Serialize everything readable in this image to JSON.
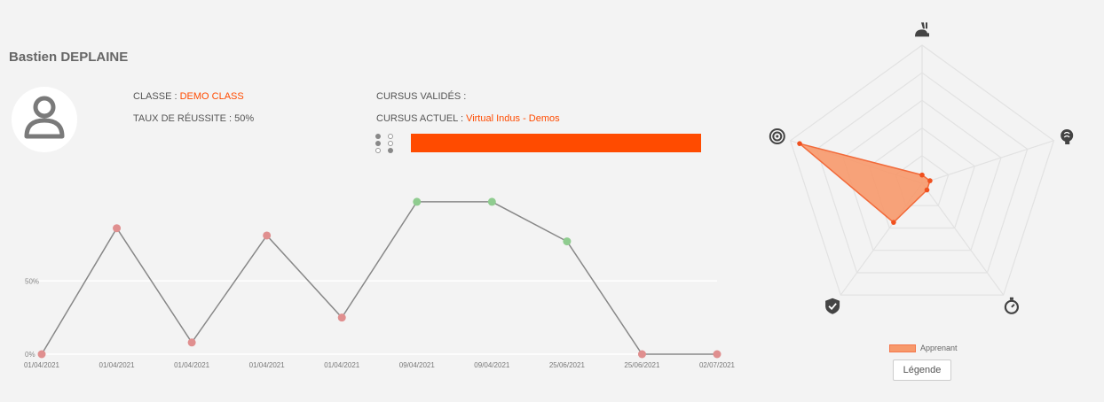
{
  "student": {
    "name": "Bastien DEPLAINE",
    "class_label": "CLASSE : ",
    "class_value": "DEMO CLASS",
    "success_label": "TAUX DE RÉUSSITE : ",
    "success_value": "50%",
    "validated_label": "CURSUS VALIDÉS :",
    "current_label": "CURSUS ACTUEL : ",
    "current_value": "Virtual Indus - Demos"
  },
  "colors": {
    "accent": "#ff4b00",
    "fail_point": "#e08f8f",
    "success_point": "#8fcc8f",
    "line": "#888888",
    "radar_fill": "#f7996b"
  },
  "chart_data": [
    {
      "type": "line",
      "x": [
        "01/04/2021",
        "01/04/2021",
        "01/04/2021",
        "01/04/2021",
        "01/04/2021",
        "09/04/2021",
        "09/04/2021",
        "25/06/2021",
        "25/06/2021",
        "02/07/2021"
      ],
      "values": [
        0,
        86,
        8,
        81,
        25,
        104,
        104,
        77,
        0,
        0
      ],
      "status": [
        "fail",
        "fail",
        "fail",
        "fail",
        "fail",
        "success",
        "success",
        "success",
        "fail",
        "fail"
      ],
      "ytick_labels": [
        "0%",
        "50%"
      ],
      "yticks": [
        0,
        50
      ],
      "ylim": [
        0,
        110
      ],
      "grid": true
    },
    {
      "type": "radar",
      "axes": [
        "rabbit-icon",
        "brain-icon",
        "stopwatch-icon",
        "shield-check-icon",
        "target-icon"
      ],
      "series": [
        {
          "name": "Apprenant",
          "values": [
            0.06,
            0.06,
            0.06,
            0.35,
            0.93
          ]
        }
      ],
      "max": 1,
      "rings": [
        1,
        0.8,
        0.6,
        0.4,
        0.2
      ]
    }
  ],
  "legend_button": "Légende"
}
